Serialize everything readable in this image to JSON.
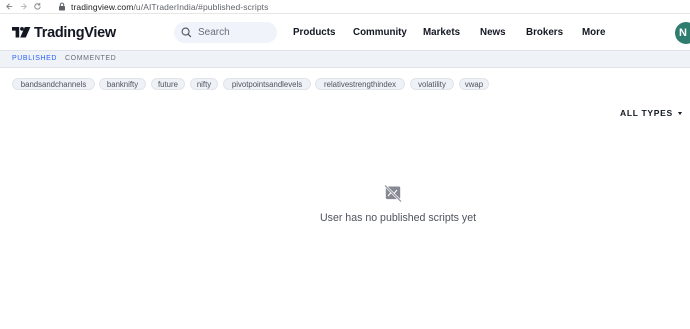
{
  "browser": {
    "url_host": "tradingview.com",
    "url_path": "/u/AITraderIndia/#published-scripts",
    "icons": {
      "back": "back-arrow-icon",
      "forward": "forward-arrow-icon",
      "lock": "lock-icon"
    }
  },
  "header": {
    "logo_text": "TradingView",
    "search_placeholder": "Search",
    "nav": [
      "Products",
      "Community",
      "Markets",
      "News",
      "Brokers",
      "More"
    ],
    "avatar_initial": "N",
    "colors": {
      "avatar": "#2e7d6e",
      "search_bg": "#f0f3fa"
    }
  },
  "tabs": [
    {
      "label": "PUBLISHED",
      "active": true
    },
    {
      "label": "COMMENTED",
      "active": false
    }
  ],
  "tags": [
    "bandsandchannels",
    "banknifty",
    "future",
    "nifty",
    "pivotpointsandlevels",
    "relativestrengthindex",
    "volatility",
    "vwap"
  ],
  "filter": {
    "label": "ALL TYPES"
  },
  "empty_state": {
    "icon": "no-scripts-icon",
    "message": "User has no published scripts yet"
  },
  "colors": {
    "accent": "#2962ff",
    "text": "#131722",
    "tab_bar": "#eff2f7"
  }
}
